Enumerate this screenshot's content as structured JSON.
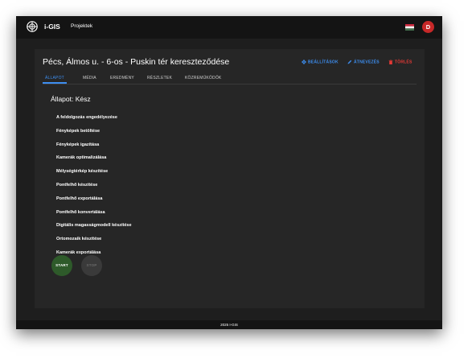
{
  "app": {
    "brand": "i-GIS",
    "nav_projects": "Projektek",
    "avatar_letter": "D",
    "icons": {
      "logo": "globe-logo-icon",
      "flag": "hungarian-flag-icon",
      "settings": "gear-icon",
      "rename": "pencil-icon",
      "delete": "trash-icon"
    }
  },
  "project": {
    "title": "Pécs, Álmos u. - 6-os - Puskin tér kereszteződése",
    "actions": {
      "settings": "BEÁLLÍTÁSOK",
      "rename": "ÁTNEVEZÉS",
      "delete": "TÖRLÉS"
    },
    "tabs": [
      {
        "label": "ÁLLAPOT",
        "active": true
      },
      {
        "label": "MÉDIA",
        "active": false
      },
      {
        "label": "EREDMÉNY",
        "active": false
      },
      {
        "label": "RÉSZLETEK",
        "active": false
      },
      {
        "label": "KÖZREMŰKÖDŐK",
        "active": false
      }
    ],
    "status": "Állapot: Kész",
    "steps": [
      "A feldolgozás engedélyezése",
      "Fényképek betöltése",
      "Fényképek igazítása",
      "Kamerák optimalizálása",
      "Mélységtérkép készítése",
      "Pontfelhő készítése",
      "Pontfelhő exportálása",
      "Pontfelhő konvertálása",
      "Digitális magasságmodell készítése",
      "Ortomozaik készítése",
      "Kamerák exportálása"
    ],
    "buttons": {
      "start": "START",
      "stop": "STOP"
    }
  },
  "colors": {
    "accent": "#3d8ef0",
    "danger": "#e53935",
    "start": "#2e5a2a",
    "background": "#1e1e1e",
    "card": "#262626"
  },
  "footer": "2025 I-GIS"
}
